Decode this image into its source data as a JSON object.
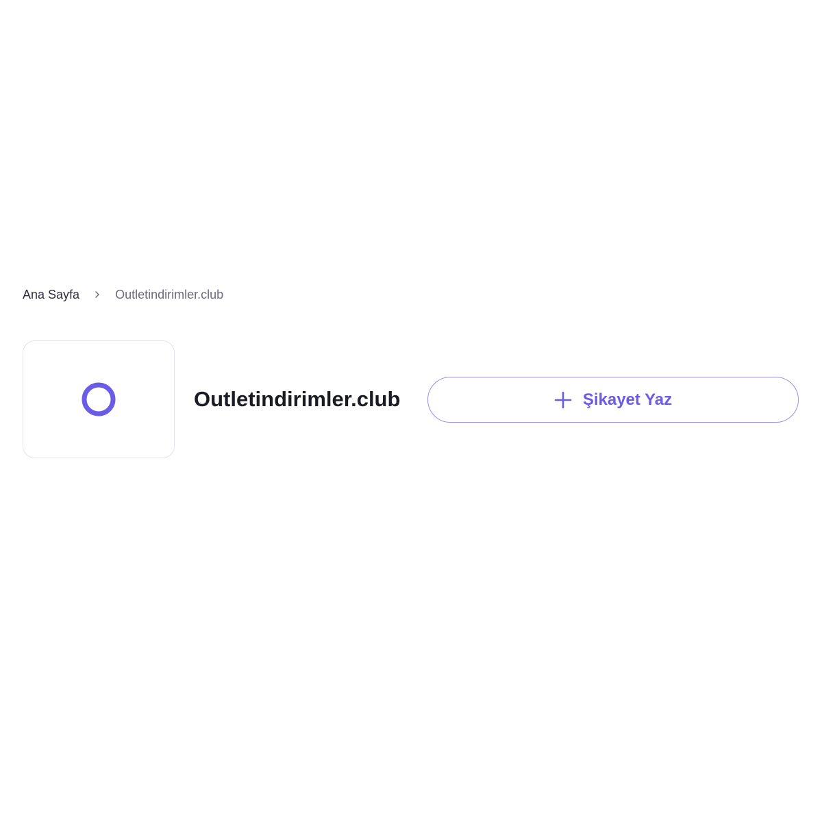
{
  "breadcrumb": {
    "home": "Ana Sayfa",
    "current": "Outletindirimler.club",
    "separator_icon": "chevron-right-icon"
  },
  "company": {
    "name": "Outletindirimler.club",
    "logo_letter": "O",
    "logo_color": "#6b5ce7"
  },
  "actions": {
    "write_complaint_label": "Şikayet Yaz",
    "write_complaint_icon": "plus-icon",
    "accent_color": "#6a5ce6"
  }
}
